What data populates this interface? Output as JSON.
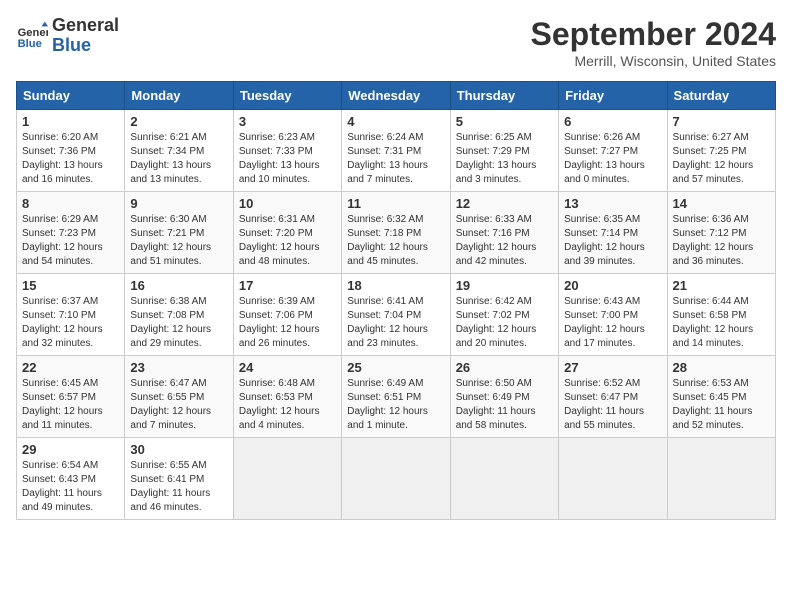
{
  "header": {
    "logo_line1": "General",
    "logo_line2": "Blue",
    "month": "September 2024",
    "location": "Merrill, Wisconsin, United States"
  },
  "days_of_week": [
    "Sunday",
    "Monday",
    "Tuesday",
    "Wednesday",
    "Thursday",
    "Friday",
    "Saturday"
  ],
  "weeks": [
    [
      {
        "num": "1",
        "rise": "Sunrise: 6:20 AM",
        "set": "Sunset: 7:36 PM",
        "daylight": "Daylight: 13 hours and 16 minutes."
      },
      {
        "num": "2",
        "rise": "Sunrise: 6:21 AM",
        "set": "Sunset: 7:34 PM",
        "daylight": "Daylight: 13 hours and 13 minutes."
      },
      {
        "num": "3",
        "rise": "Sunrise: 6:23 AM",
        "set": "Sunset: 7:33 PM",
        "daylight": "Daylight: 13 hours and 10 minutes."
      },
      {
        "num": "4",
        "rise": "Sunrise: 6:24 AM",
        "set": "Sunset: 7:31 PM",
        "daylight": "Daylight: 13 hours and 7 minutes."
      },
      {
        "num": "5",
        "rise": "Sunrise: 6:25 AM",
        "set": "Sunset: 7:29 PM",
        "daylight": "Daylight: 13 hours and 3 minutes."
      },
      {
        "num": "6",
        "rise": "Sunrise: 6:26 AM",
        "set": "Sunset: 7:27 PM",
        "daylight": "Daylight: 13 hours and 0 minutes."
      },
      {
        "num": "7",
        "rise": "Sunrise: 6:27 AM",
        "set": "Sunset: 7:25 PM",
        "daylight": "Daylight: 12 hours and 57 minutes."
      }
    ],
    [
      {
        "num": "8",
        "rise": "Sunrise: 6:29 AM",
        "set": "Sunset: 7:23 PM",
        "daylight": "Daylight: 12 hours and 54 minutes."
      },
      {
        "num": "9",
        "rise": "Sunrise: 6:30 AM",
        "set": "Sunset: 7:21 PM",
        "daylight": "Daylight: 12 hours and 51 minutes."
      },
      {
        "num": "10",
        "rise": "Sunrise: 6:31 AM",
        "set": "Sunset: 7:20 PM",
        "daylight": "Daylight: 12 hours and 48 minutes."
      },
      {
        "num": "11",
        "rise": "Sunrise: 6:32 AM",
        "set": "Sunset: 7:18 PM",
        "daylight": "Daylight: 12 hours and 45 minutes."
      },
      {
        "num": "12",
        "rise": "Sunrise: 6:33 AM",
        "set": "Sunset: 7:16 PM",
        "daylight": "Daylight: 12 hours and 42 minutes."
      },
      {
        "num": "13",
        "rise": "Sunrise: 6:35 AM",
        "set": "Sunset: 7:14 PM",
        "daylight": "Daylight: 12 hours and 39 minutes."
      },
      {
        "num": "14",
        "rise": "Sunrise: 6:36 AM",
        "set": "Sunset: 7:12 PM",
        "daylight": "Daylight: 12 hours and 36 minutes."
      }
    ],
    [
      {
        "num": "15",
        "rise": "Sunrise: 6:37 AM",
        "set": "Sunset: 7:10 PM",
        "daylight": "Daylight: 12 hours and 32 minutes."
      },
      {
        "num": "16",
        "rise": "Sunrise: 6:38 AM",
        "set": "Sunset: 7:08 PM",
        "daylight": "Daylight: 12 hours and 29 minutes."
      },
      {
        "num": "17",
        "rise": "Sunrise: 6:39 AM",
        "set": "Sunset: 7:06 PM",
        "daylight": "Daylight: 12 hours and 26 minutes."
      },
      {
        "num": "18",
        "rise": "Sunrise: 6:41 AM",
        "set": "Sunset: 7:04 PM",
        "daylight": "Daylight: 12 hours and 23 minutes."
      },
      {
        "num": "19",
        "rise": "Sunrise: 6:42 AM",
        "set": "Sunset: 7:02 PM",
        "daylight": "Daylight: 12 hours and 20 minutes."
      },
      {
        "num": "20",
        "rise": "Sunrise: 6:43 AM",
        "set": "Sunset: 7:00 PM",
        "daylight": "Daylight: 12 hours and 17 minutes."
      },
      {
        "num": "21",
        "rise": "Sunrise: 6:44 AM",
        "set": "Sunset: 6:58 PM",
        "daylight": "Daylight: 12 hours and 14 minutes."
      }
    ],
    [
      {
        "num": "22",
        "rise": "Sunrise: 6:45 AM",
        "set": "Sunset: 6:57 PM",
        "daylight": "Daylight: 12 hours and 11 minutes."
      },
      {
        "num": "23",
        "rise": "Sunrise: 6:47 AM",
        "set": "Sunset: 6:55 PM",
        "daylight": "Daylight: 12 hours and 7 minutes."
      },
      {
        "num": "24",
        "rise": "Sunrise: 6:48 AM",
        "set": "Sunset: 6:53 PM",
        "daylight": "Daylight: 12 hours and 4 minutes."
      },
      {
        "num": "25",
        "rise": "Sunrise: 6:49 AM",
        "set": "Sunset: 6:51 PM",
        "daylight": "Daylight: 12 hours and 1 minute."
      },
      {
        "num": "26",
        "rise": "Sunrise: 6:50 AM",
        "set": "Sunset: 6:49 PM",
        "daylight": "Daylight: 11 hours and 58 minutes."
      },
      {
        "num": "27",
        "rise": "Sunrise: 6:52 AM",
        "set": "Sunset: 6:47 PM",
        "daylight": "Daylight: 11 hours and 55 minutes."
      },
      {
        "num": "28",
        "rise": "Sunrise: 6:53 AM",
        "set": "Sunset: 6:45 PM",
        "daylight": "Daylight: 11 hours and 52 minutes."
      }
    ],
    [
      {
        "num": "29",
        "rise": "Sunrise: 6:54 AM",
        "set": "Sunset: 6:43 PM",
        "daylight": "Daylight: 11 hours and 49 minutes."
      },
      {
        "num": "30",
        "rise": "Sunrise: 6:55 AM",
        "set": "Sunset: 6:41 PM",
        "daylight": "Daylight: 11 hours and 46 minutes."
      },
      null,
      null,
      null,
      null,
      null
    ]
  ]
}
